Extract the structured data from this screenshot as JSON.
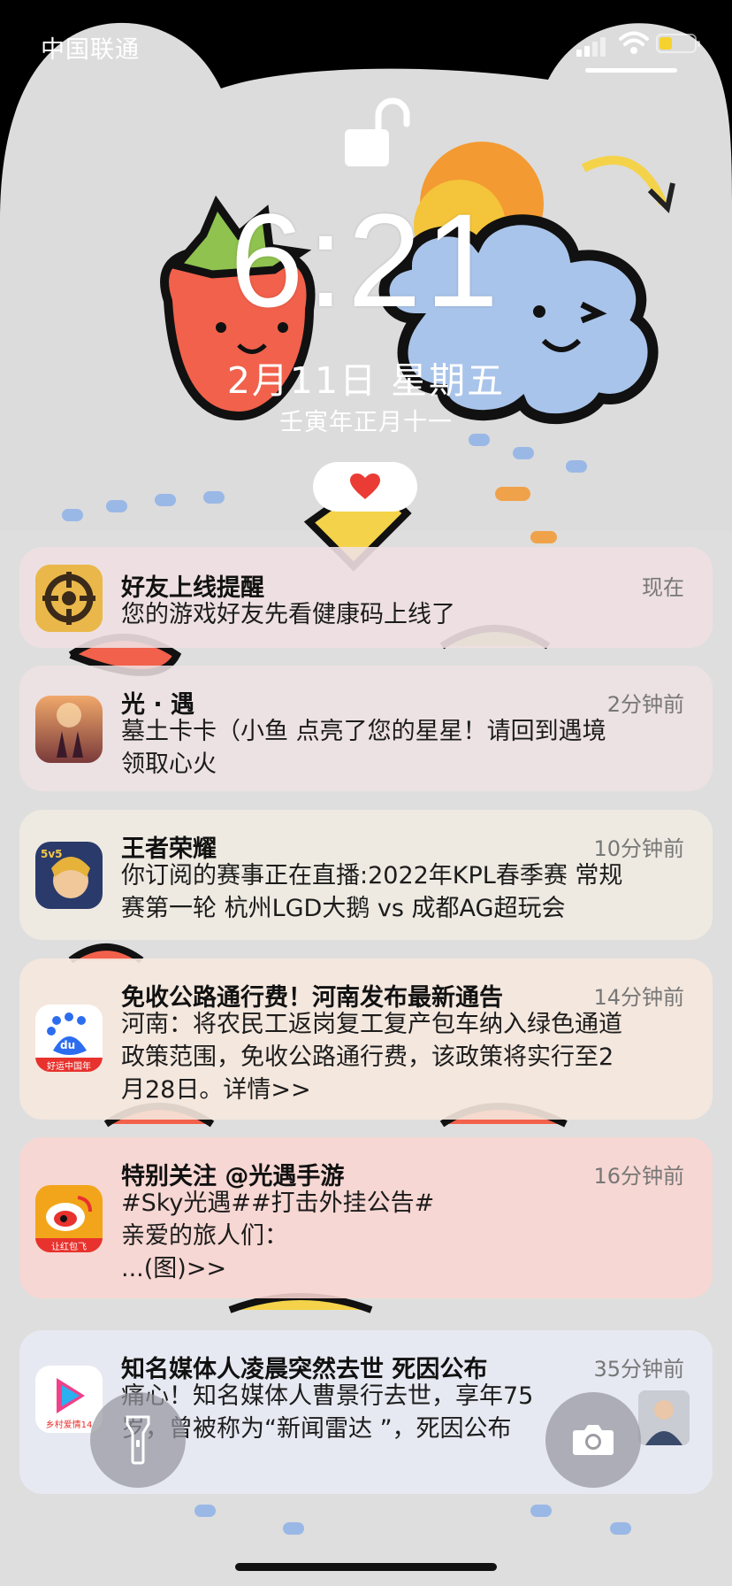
{
  "status_bar": {
    "carrier": "中国联通",
    "battery_level": 0.36
  },
  "lock_screen": {
    "time": "6:21",
    "date": "2月11日 星期五",
    "lunar_date": "壬寅年正月十一"
  },
  "notifications": [
    {
      "app_icon": "game-peace-elite-icon",
      "title": "好友上线提醒",
      "time": "现在",
      "body": "您的游戏好友先看健康码上线了"
    },
    {
      "app_icon": "sky-game-icon",
      "title": "光 · 遇",
      "time": "2分钟前",
      "body": "墓土卡卡（小鱼 点亮了您的星星！请回到遇境\n领取心火"
    },
    {
      "app_icon": "honor-of-kings-icon",
      "title": "王者荣耀",
      "time": "10分钟前",
      "body": "你订阅的赛事正在直播:2022年KPL春季赛 常规\n赛第一轮 杭州LGD大鹅 vs 成都AG超玩会"
    },
    {
      "app_icon": "baidu-icon",
      "app_icon_text": "好运中国年",
      "title": "免收公路通行费！河南发布最新通告",
      "time": "14分钟前",
      "body": "河南：将农民工返岗复工复产包车纳入绿色通道\n政策范围，免收公路通行费，该政策将实行至2\n月28日。详情>>"
    },
    {
      "app_icon": "weibo-icon",
      "app_icon_text": "让红包飞",
      "title": "特别关注 @光遇手游",
      "time": "16分钟前",
      "body": "#Sky光遇##打击外挂公告#\n亲爱的旅人们：\n      ...(图)>>"
    },
    {
      "app_icon": "video-app-icon",
      "app_icon_text": "乡村爱情14",
      "title": "知名媒体人凌晨突然去世 死因公布",
      "time": "35分钟前",
      "body": "痛心！知名媒体人曹景行去世，享年75\n岁，曾被称为“新闻雷达 ”，死因公布"
    }
  ],
  "quick_actions": {
    "left": "flashlight-icon",
    "right": "camera-icon"
  }
}
